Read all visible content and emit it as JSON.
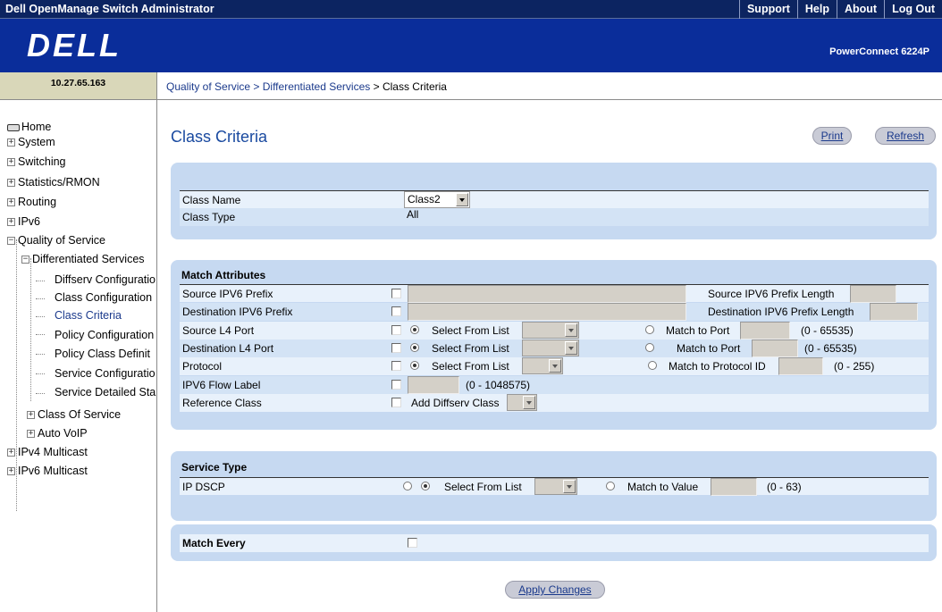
{
  "topbar": {
    "title": "Dell OpenManage Switch Administrator",
    "links": [
      "Support",
      "Help",
      "About",
      "Log Out"
    ]
  },
  "banner": {
    "logo": "DELL",
    "model": "PowerConnect 6224P"
  },
  "ip": "10.27.65.163",
  "breadcrumb": {
    "part1": "Quality of Service",
    "sep": " > ",
    "part2": "Differentiated Services",
    "current": "Class Criteria"
  },
  "sidebar": {
    "home": "Home",
    "system": "System",
    "switching": "Switching",
    "statistics": "Statistics/RMON",
    "routing": "Routing",
    "ipv6": "IPv6",
    "qos": "Quality of Service",
    "diffserv": "Differentiated Services",
    "diffserv_config": "Diffserv Configuratio",
    "class_config": "Class Configuration",
    "class_criteria": "Class Criteria",
    "policy_config": "Policy Configuration",
    "policy_class_def": "Policy Class Definit",
    "service_config": "Service Configuratio",
    "service_detailed": "Service Detailed Sta",
    "class_of_service": "Class Of Service",
    "auto_voip": "Auto VoIP",
    "ipv4_multicast": "IPv4 Multicast",
    "ipv6_multicast": "IPv6 Multicast"
  },
  "page": {
    "title": "Class Criteria",
    "print": "Print",
    "refresh": "Refresh"
  },
  "class_panel": {
    "class_name_label": "Class Name",
    "class_name_value": "Class2",
    "class_type_label": "Class Type",
    "class_type_value": "All"
  },
  "match": {
    "header": "Match Attributes",
    "src_ipv6_prefix": "Source IPV6 Prefix",
    "src_ipv6_prefix_len": "Source IPV6 Prefix Length",
    "dst_ipv6_prefix": "Destination IPV6 Prefix",
    "dst_ipv6_prefix_len": "Destination IPV6 Prefix Length",
    "src_l4_port": "Source L4 Port",
    "dst_l4_port": "Destination L4 Port",
    "protocol": "Protocol",
    "ipv6_flow_label": "IPV6 Flow Label",
    "reference_class": "Reference Class",
    "select_from_list": "Select From List",
    "match_to_port": "Match to Port",
    "port_range": "(0 - 65535)",
    "match_to_protocol_id": "Match to Protocol ID",
    "protocol_range": "(0 - 255)",
    "flow_range": "(0 - 1048575)",
    "add_diffserv_class": "Add Diffserv Class"
  },
  "service": {
    "header": "Service Type",
    "ip_dscp": "IP DSCP",
    "select_from_list": "Select From List",
    "match_to_value": "Match to Value",
    "range": "(0 - 63)"
  },
  "match_every": {
    "label": "Match Every"
  },
  "apply": "Apply Changes"
}
